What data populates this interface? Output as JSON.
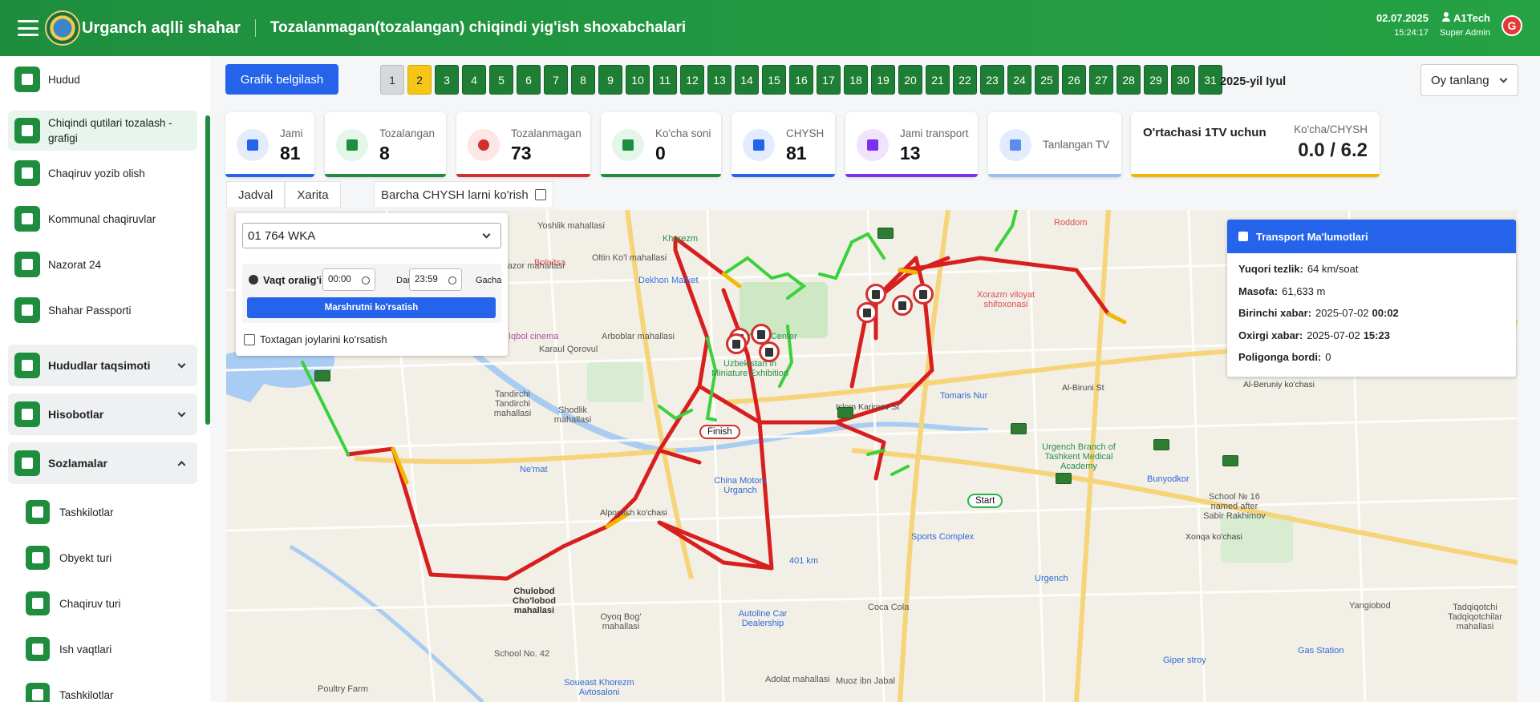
{
  "header": {
    "app_title": "Urganch aqlli shahar",
    "page_title": "Tozalanmagan(tozalangan) chiqindi yig'ish shoxabchalari",
    "date": "02.07.2025",
    "time": "15:24:17",
    "user_name": "A1Tech",
    "user_role": "Super Admin",
    "avatar_letter": "G"
  },
  "sidebar": {
    "items": [
      {
        "label": "Hudud"
      },
      {
        "label": "Chiqindi qutilari tozalash - grafigi"
      },
      {
        "label": "Chaqiruv yozib olish"
      },
      {
        "label": "Kommunal chaqiruvlar"
      },
      {
        "label": "Nazorat 24"
      },
      {
        "label": "Shahar Passporti"
      }
    ],
    "groups": [
      {
        "label": "Hududlar taqsimoti"
      },
      {
        "label": "Hisobotlar"
      },
      {
        "label": "Sozlamalar"
      }
    ],
    "sub_items": [
      {
        "label": "Tashkilotlar"
      },
      {
        "label": "Obyekt turi"
      },
      {
        "label": "Chaqiruv turi"
      },
      {
        "label": "Ish vaqtlari"
      },
      {
        "label": "Tashkilotlar"
      }
    ]
  },
  "toolbar": {
    "grafik_button": "Grafik belgilash",
    "days": [
      "1",
      "2",
      "3",
      "4",
      "5",
      "6",
      "7",
      "8",
      "9",
      "10",
      "11",
      "12",
      "13",
      "14",
      "15",
      "16",
      "17",
      "18",
      "19",
      "20",
      "21",
      "22",
      "23",
      "24",
      "25",
      "26",
      "27",
      "28",
      "29",
      "30",
      "31"
    ],
    "selected_day": "2",
    "month_label": "2025-yil Iyul",
    "month_select": "Oy tanlang"
  },
  "stats": {
    "jami": {
      "label": "Jami",
      "value": "81"
    },
    "tozalangan": {
      "label": "Tozalangan",
      "value": "8"
    },
    "tozalanmagan": {
      "label": "Tozalanmagan",
      "value": "73"
    },
    "kocha_soni": {
      "label": "Ko'cha soni",
      "value": "0"
    },
    "chysh": {
      "label": "CHYSH",
      "value": "81"
    },
    "jami_transport": {
      "label": "Jami transport",
      "value": "13"
    },
    "tanlangan_tv": {
      "label": "Tanlangan TV"
    },
    "ortacha": {
      "title": "O'rtachasi 1TV uchun",
      "sub_label": "Ko'cha/CHYSH",
      "value": "0.0 / 6.2"
    }
  },
  "tabs": {
    "jadval": "Jadval",
    "xarita": "Xarita",
    "show_all": "Barcha CHYSH larni ko'rish"
  },
  "control_panel": {
    "vehicle": "01 764 WKA",
    "time_label": "Vaqt oralig'i",
    "from_time": "00:00",
    "dan": "Dan",
    "to_time": "23:59",
    "gacha": "Gacha",
    "route_button": "Marshrutni ko'rsatish",
    "stops_label": "Toxtagan joylarini ko'rsatish"
  },
  "transport_info": {
    "title": "Transport Ma'lumotlari",
    "max_speed_label": "Yuqori tezlik:",
    "max_speed": "64 km/soat",
    "distance_label": "Masofa:",
    "distance": "61,633 m",
    "first_label": "Birinchi xabar:",
    "first_date": "2025-07-02",
    "first_time": "00:02",
    "last_label": "Oxirgi xabar:",
    "last_date": "2025-07-02",
    "last_time": "15:23",
    "landfill_label": "Poligonga bordi:",
    "landfill": "0"
  },
  "map": {
    "finish": "Finish",
    "start": "Start",
    "labels": {
      "yoshlik": "Yoshlik mahallasi",
      "oltin": "Oltin Ko'l mahallasi",
      "mevazor": "Mevazor mahallasi",
      "bolnitsa": "Bolnitsa",
      "dekhon": "Dekhon Market",
      "khorezm": "Khorezm",
      "youth": "Youth Center",
      "uzb": "Uzbekistan in Miniature Exhibition",
      "arboblar": "Arboblar mahallasi",
      "karaul": "Karaul Qorovul",
      "iqbol": "Iqbol cinema",
      "tandirchi": "Tandirchi Tandirchi mahallasi",
      "shodlik": "Shodlik mahallasi",
      "nemat": "Ne'mat",
      "china": "China Motors Urganch",
      "alpomish": "Alpomish ko'chasi",
      "islom": "Islom Karimov St",
      "alberuni": "Al-Biruni St",
      "alberuni2": "Al-Beruniy ko'chasi",
      "xorazm": "Xorazm viloyat shifoxonasi",
      "roddom": "Roddom",
      "tomaris": "Tomaris Nur",
      "urgench_branch": "Urgench Branch of Tashkent Medical Academy",
      "sports": "Sports Complex",
      "urgench": "Urgench",
      "401": "401 km",
      "xonqa": "Xonqa ko'chasi",
      "chulobod": "Chulobod Cho'lobod mahallasi",
      "oyoq": "Oyoq Bog' mahallasi",
      "autoline": "Autoline Car Dealership",
      "cocacola": "Coca Cola",
      "soueast": "Soueast Khorezm Avtosaloni",
      "school42": "School No. 42",
      "poultry": "Poultry Farm",
      "adolat": "Adolat mahallasi",
      "muoz": "Muoz ibn Jabal",
      "giper": "Giper stroy",
      "gas": "Gas Station",
      "tadqiqotchi": "Tadqiqotchi Tadqiqotchilar mahallasi",
      "school16": "School № 16 named after Sabir Rakhimov",
      "bunyodkor": "Bunyodkor",
      "yangi": "Yangiobod",
      "tozalanmagan": ""
    }
  },
  "colors": {
    "brand_green": "#1e8e3e",
    "primary_blue": "#2563eb",
    "red": "#d32f2f",
    "yellow": "#f5c518"
  }
}
